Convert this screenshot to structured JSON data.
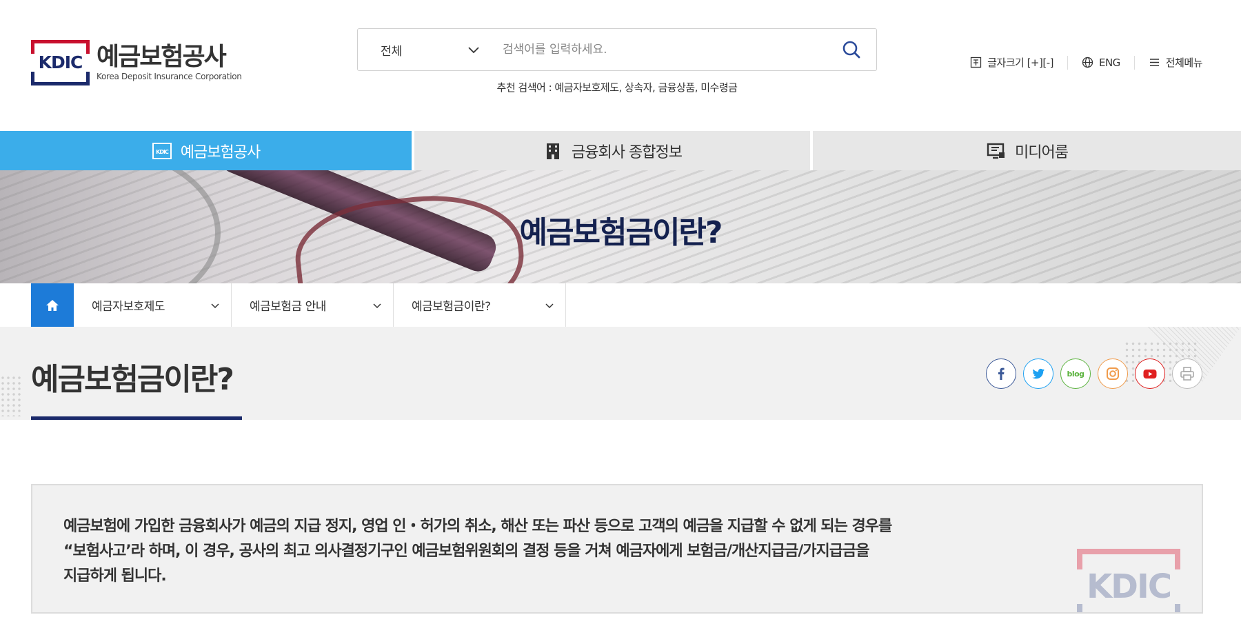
{
  "header": {
    "logo": {
      "mark_text": "KDIC",
      "name_kr": "예금보험공사",
      "name_en": "Korea Deposit Insurance Corporation"
    },
    "search": {
      "scope": "전체",
      "placeholder": "검색어를 입력하세요."
    },
    "recommend": {
      "label": "추천 검색어 : ",
      "items": [
        "예금자보호제도",
        "상속자",
        "금융상품",
        "미수령금"
      ]
    },
    "util": {
      "font_size": "글자크기 [+][-]",
      "language": "ENG",
      "all_menu": "전체메뉴"
    }
  },
  "mainnav": {
    "tabs": [
      {
        "label": "예금보험공사",
        "icon": "kdic-logo-icon",
        "active": true
      },
      {
        "label": "금융회사 종합정보",
        "icon": "building-icon",
        "active": false
      },
      {
        "label": "미디어룸",
        "icon": "media-icon",
        "active": false
      }
    ]
  },
  "hero": {
    "title": "예금보험금이란?"
  },
  "breadcrumb": {
    "items": [
      {
        "label": "예금자보호제도"
      },
      {
        "label": "예금보험금 안내"
      },
      {
        "label": "예금보험금이란?"
      }
    ]
  },
  "page": {
    "title": "예금보험금이란?",
    "sns": [
      "facebook",
      "twitter",
      "blog",
      "instagram",
      "youtube",
      "print"
    ],
    "blog_label": "blog",
    "info_lines": [
      "예금보험에 가입한 금융회사가 예금의 지급 정지, 영업 인・허가의 취소, 해산 또는 파산 등으로 고객의 예금을 지급할 수 없게 되는 경우를",
      "“보험사고’라 하며, 이 경우, 공사의 최고 의사결정기구인 예금보험위원회의 결정 등을 거쳐 예금자에게 보험금/개산지급금/가지급금을",
      "지급하게 됩니다."
    ],
    "watermark": "KDIC"
  },
  "colors": {
    "accent_blue": "#3badea",
    "home_blue": "#1d7bd8",
    "navy": "#1b2a6b",
    "logo_red": "#c8102e"
  }
}
